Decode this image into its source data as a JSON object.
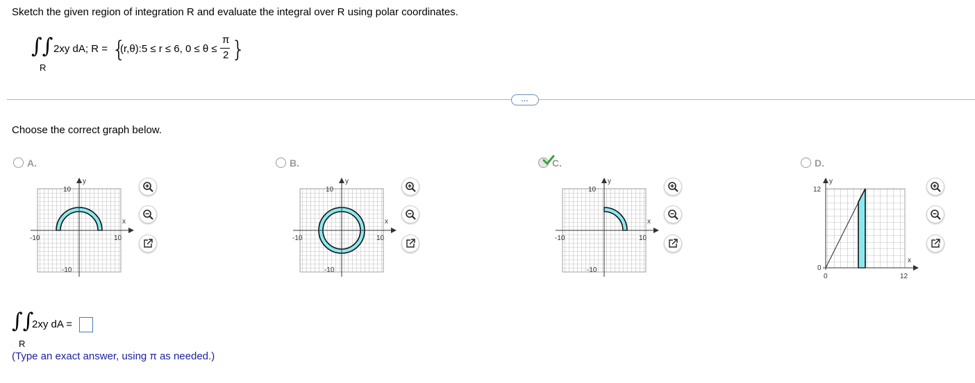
{
  "question": {
    "instruction": "Sketch the given region of integration R and evaluate the integral over R using polar coordinates.",
    "integrand": "2xy dA; R =",
    "region_set": "(r,θ):5 ≤ r ≤ 6, 0 ≤ θ ≤",
    "pi_num": "π",
    "pi_den": "2",
    "region_sub": "R"
  },
  "expand_button": "...",
  "prompt": "Choose the correct graph below.",
  "options": [
    {
      "letter": "A.",
      "axis_y": "y",
      "axis_x": "x",
      "tick_top": "10",
      "tick_left": "-10",
      "tick_right": "10",
      "tick_bottom": "-10",
      "selected": false
    },
    {
      "letter": "B.",
      "axis_y": "y",
      "axis_x": "x",
      "tick_top": "10",
      "tick_left": "-10",
      "tick_right": "10",
      "tick_bottom": "-10",
      "selected": false
    },
    {
      "letter": "C.",
      "axis_y": "y",
      "axis_x": "x",
      "tick_top": "10",
      "tick_left": "-10",
      "tick_right": "10",
      "tick_bottom": "-10",
      "selected": true
    },
    {
      "letter": "D.",
      "axis_y": "y",
      "axis_x": "x",
      "tick_top": "12",
      "tick_origin_y": "0",
      "tick_origin_x": "0",
      "tick_right": "12",
      "selected": false
    }
  ],
  "answer": {
    "integrand": "2xy dA =",
    "sub": "R",
    "value": ""
  },
  "hint": "(Type an exact answer, using π as needed.)",
  "colors": {
    "region_fill": "#8ce8ef",
    "checkmark": "#3aa33a",
    "hint_text": "#1b1f9e"
  },
  "icons": [
    "zoom-in-icon",
    "zoom-out-icon",
    "open-new-window-icon",
    "checkmark-icon"
  ]
}
